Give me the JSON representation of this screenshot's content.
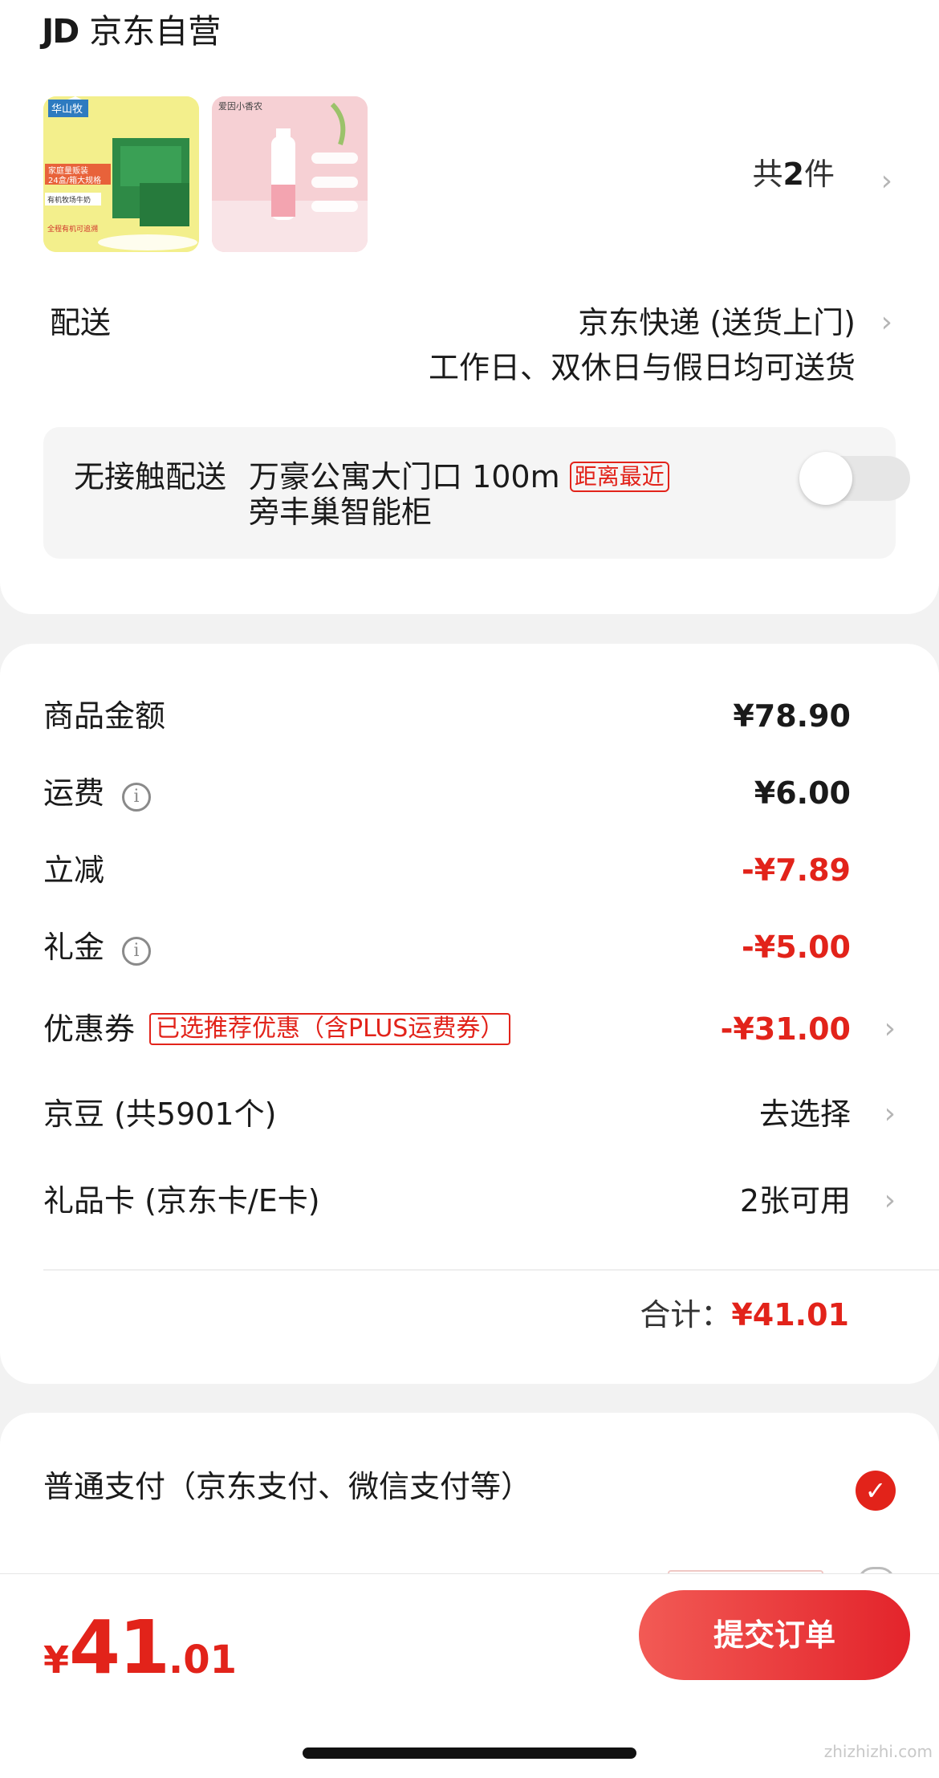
{
  "store": {
    "jd_logo": "JD",
    "name": "京东自营"
  },
  "products": {
    "thumb1": {
      "brand": "华山牧",
      "text_1": "家庭量贩装",
      "text_2": "24盒/箱大规格",
      "text_3": "有机牧场牛奶",
      "text_4": "全程有机可追溯"
    },
    "thumb2": {
      "brand": "爱因小香农"
    },
    "count_prefix": "共",
    "count_num": "2",
    "count_suffix": "件"
  },
  "delivery": {
    "label": "配送",
    "method": "京东快递 (送货上门)",
    "schedule": "工作日、双休日与假日均可送货"
  },
  "contactless": {
    "label": "无接触配送",
    "location_line1": "万豪公寓大门口 100m",
    "tag": "距离最近",
    "location_line2": "旁丰巢智能柜",
    "toggle_on": false
  },
  "price_rows": [
    {
      "label": "商品金额",
      "value": "¥78.90"
    },
    {
      "label": "运费",
      "value": "¥6.00"
    },
    {
      "label": "立减",
      "value": "-¥7.89"
    },
    {
      "label": "礼金",
      "value": "-¥5.00"
    },
    {
      "label": "优惠券",
      "tag": "已选推荐优惠（含PLUS运费券）",
      "value": "-¥31.00"
    },
    {
      "label": "京豆 (共5901个)",
      "value": "去选择"
    },
    {
      "label": "礼品卡 (京东卡/E卡)",
      "value": "2张可用"
    }
  ],
  "total": {
    "label": "合计：",
    "value": "¥41.01"
  },
  "payment": {
    "option_label": "普通支付（京东支付、微信支付等）",
    "selected": true
  },
  "bottom_bar": {
    "currency": "¥",
    "integer": "41",
    "decimal": ".01",
    "submit_label": "提交订单"
  },
  "watermark": "zhizhizhi.com",
  "icons": {
    "chevron": "›",
    "info": "i",
    "check": "✓"
  },
  "colors": {
    "accent": "#e2231a",
    "bg": "#f2f2f2"
  }
}
